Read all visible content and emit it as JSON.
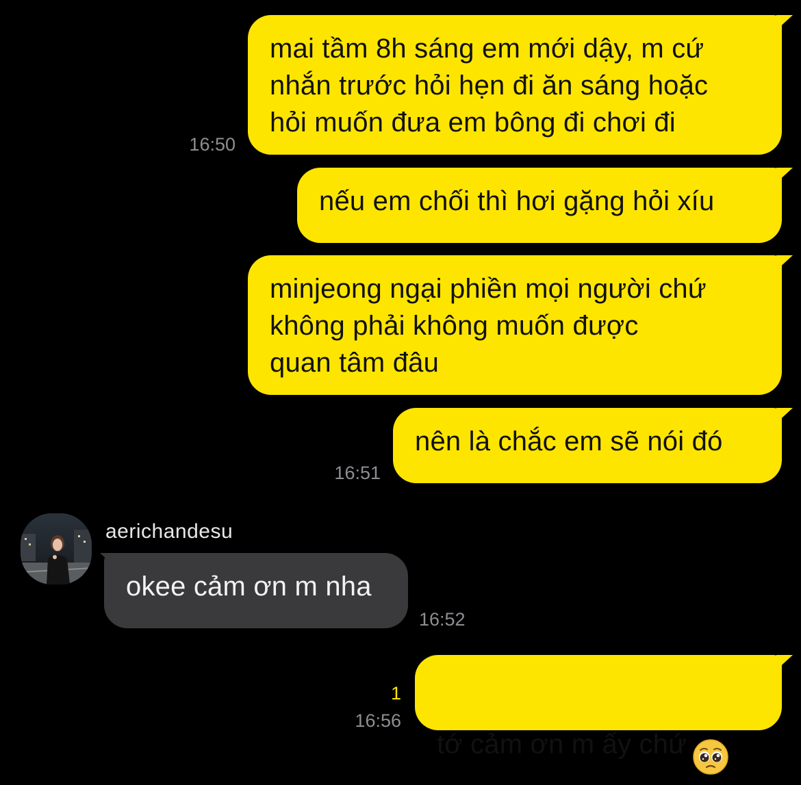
{
  "chat": {
    "messages": [
      {
        "id": "m1",
        "sender": "me",
        "text": "mai tầm 8h sáng em mới dậy, m cứ\nnhắn trước hỏi hẹn đi ăn sáng hoặc\nhỏi muốn đưa em bông đi chơi đi",
        "time": "16:50"
      },
      {
        "id": "m2",
        "sender": "me",
        "text": "nếu em chối thì hơi gặng hỏi xíu"
      },
      {
        "id": "m3",
        "sender": "me",
        "text": "minjeong ngại phiền mọi người chứ\nkhông phải không muốn được\nquan tâm đâu"
      },
      {
        "id": "m4",
        "sender": "me",
        "text": "nên là chắc em sẽ nói đó",
        "time": "16:51"
      },
      {
        "id": "m5",
        "sender": "them",
        "sender_name": "aerichandesu",
        "text": "okee cảm ơn m nha",
        "time": "16:52"
      },
      {
        "id": "m6",
        "sender": "me",
        "text": "tớ cảm ơn m ấy chứ",
        "emoji": "pleading-face",
        "time": "16:56",
        "unread_count": "1"
      }
    ]
  },
  "colors": {
    "background": "#000000",
    "outgoing_bubble": "#fee500",
    "incoming_bubble": "#3a3a3c",
    "timestamp": "#8e8e93",
    "unread_count": "#fee500"
  }
}
